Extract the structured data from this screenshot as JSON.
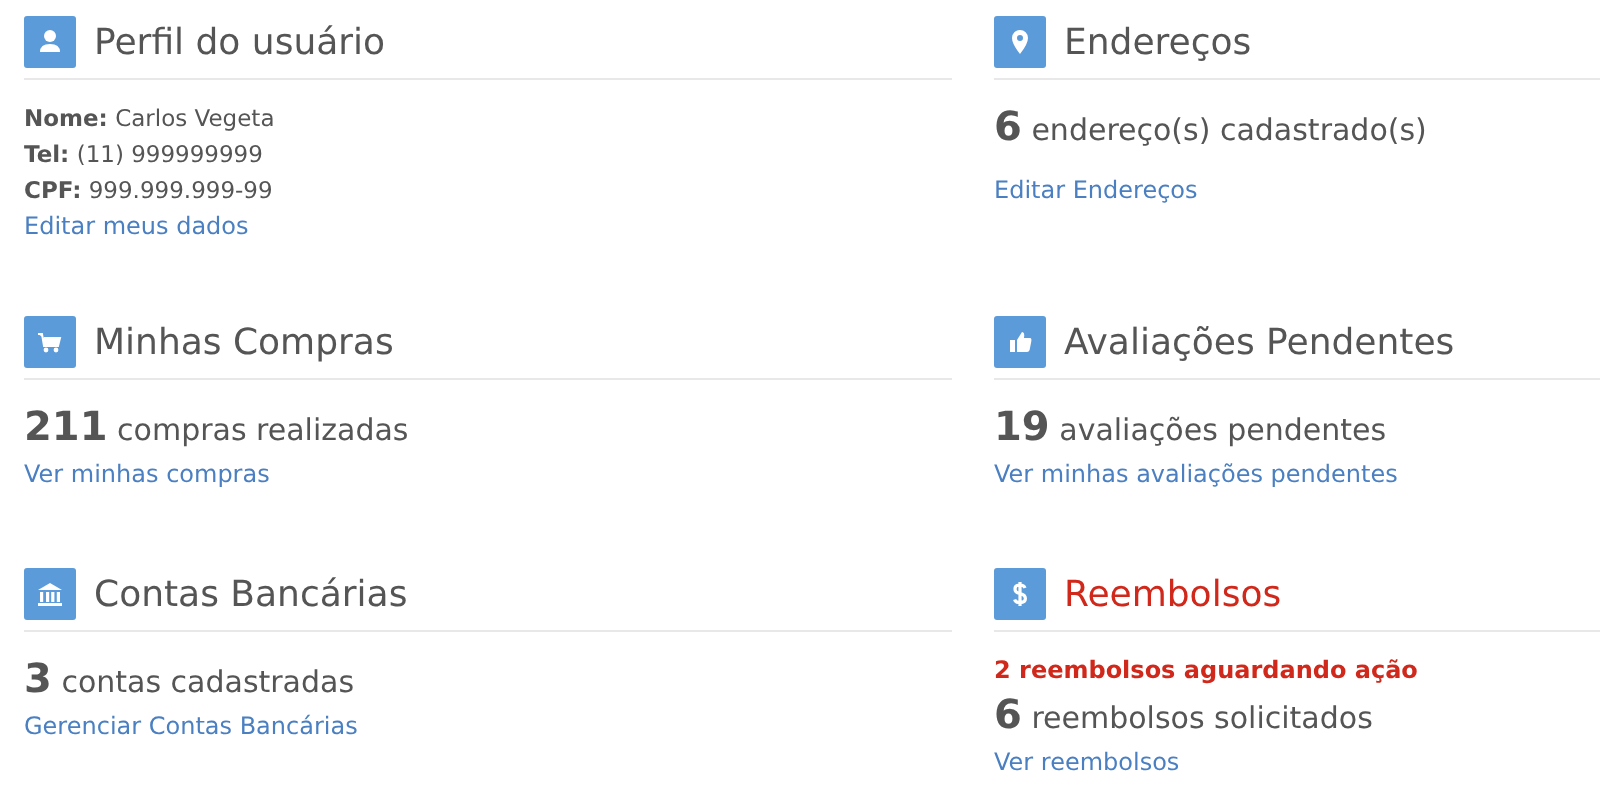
{
  "sections": [
    {
      "kind": "details",
      "title": "Perfil do usuário",
      "alert": false,
      "details": [
        {
          "label": "Nome:",
          "value": "Carlos Vegeta"
        },
        {
          "label": "Tel:",
          "value": "(11) 999999999"
        },
        {
          "label": "CPF:",
          "value": "999.999.999-99"
        }
      ],
      "link": "Editar meus dados"
    },
    {
      "kind": "count",
      "title": "Endereços",
      "alert": false,
      "count": "6",
      "count_text": "endereço(s) cadastrado(s)",
      "link": "Editar Endereços"
    },
    {
      "kind": "count",
      "title": "Minhas Compras",
      "alert": false,
      "count": "211",
      "count_text": "compras realizadas",
      "link": "Ver minhas compras"
    },
    {
      "kind": "count",
      "title": "Avaliações Pendentes",
      "alert": false,
      "count": "19",
      "count_text": "avaliações pendentes",
      "link": "Ver minhas avaliações pendentes"
    },
    {
      "kind": "count",
      "title": "Contas Bancárias",
      "alert": false,
      "count": "3",
      "count_text": "contas cadastradas",
      "link": "Gerenciar Contas Bancárias"
    },
    {
      "kind": "count",
      "title": "Reembolsos",
      "alert": true,
      "notice": "2 reembolsos aguardando ação",
      "count": "6",
      "count_text": "reembolsos solicitados",
      "link": "Ver reembolsos"
    }
  ]
}
